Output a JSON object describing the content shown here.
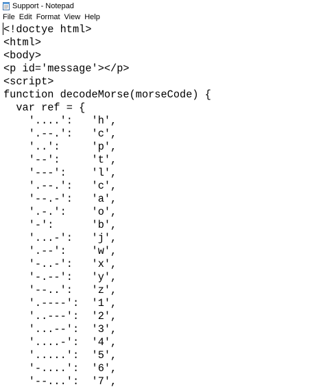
{
  "window": {
    "title": "Support - Notepad",
    "icon": "notepad-icon"
  },
  "menu": [
    "File",
    "Edit",
    "Format",
    "View",
    "Help"
  ],
  "editor": {
    "lines": [
      "<!doctye html>",
      "<html>",
      "<body>",
      "<p id='message'></p>",
      "<script>",
      "function decodeMorse(morseCode) {",
      "  var ref = {",
      "    '....':   'h',",
      "    '.--.':   'c',",
      "    '..':     'p',",
      "    '--':     't',",
      "    '---':    'l',",
      "    '.--.':   'c',",
      "    '--.-':   'a',",
      "    '.-.':    'o',",
      "    '-':      'b',",
      "    '...-':   'j',",
      "    '.--':    'w',",
      "    '-..-':   'x',",
      "    '-.--':   'y',",
      "    '--..':   'z',",
      "    '.----':  '1',",
      "    '..---':  '2',",
      "    '...--':  '3',",
      "    '....-':  '4',",
      "    '.....':  '5',",
      "    '-....':  '6',",
      "    '--...':  '7',"
    ]
  }
}
